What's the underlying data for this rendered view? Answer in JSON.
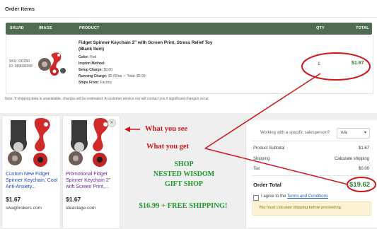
{
  "orders": {
    "title": "Order Items",
    "columns": [
      "SKU/ID",
      "IMAGE",
      "PRODUCT",
      "QTY",
      "TOTAL"
    ],
    "row": {
      "sku_label": "SKU:",
      "sku": "OD250",
      "id_label": "ID:",
      "id": "389030268",
      "product_name": "Fidget Spinner Keychain 2\" with Screen Print, Stress Relief Toy (Blank Item)",
      "color_label": "Color:",
      "color": "Red",
      "imprint_label": "Imprint Method:",
      "imprint": "",
      "setup_label": "Setup Charge:",
      "setup": "$0.00",
      "running_label": "Running Charge:",
      "running": "$0.00/ea",
      "total_label": "Total:",
      "running_total": "$0.00",
      "ships_label": "Ships From:",
      "ships": "Factory",
      "qty": "1",
      "total": "$1.67"
    },
    "note": "Note: If shipping data is unavailable, charges will be estimated. A customer service rep will contact you if significant changes occur."
  },
  "ads": [
    {
      "title": "Custom New Fidget Spinner Keychain, Cool Anti-Anxiety...",
      "price": "$1.67",
      "site": "swagbrokers.com",
      "title_color": "#1a47b8"
    },
    {
      "title": "Promotional Fidget Spinner Keychain 2\" with Screen Print,...",
      "price": "$1.67",
      "site": "ideastage.com",
      "title_color": "#6a2aa0"
    }
  ],
  "annotations": {
    "what_you_see": "What you see",
    "what_you_get": "What you get",
    "shop_line1": "SHOP",
    "shop_line2": "NESTED WISDOM",
    "shop_line3": "GIFT SHOP",
    "offer": "$16.99 + FREE SHIPPING!"
  },
  "summary": {
    "salesperson_q": "Working with a specific salesperson?",
    "salesperson_value": "n/a",
    "product_subtotal_label": "Product Subtotal",
    "product_subtotal": "$1.67",
    "shipping_label": "Shipping",
    "shipping_value": "Calculate shipping",
    "tax_label": "Tax",
    "tax": "$0.00",
    "order_total_label": "Order Total",
    "order_total": "$19.62",
    "agree_prefix": "I agree to the ",
    "terms_link": "Terms and Conditions",
    "warning": "You must calculate shipping before proceeding."
  },
  "colors": {
    "header_green": "#4f6b52",
    "total_green": "#2f7d32",
    "annotation_red": "#d0161c",
    "offer_green": "#1f9a2a"
  }
}
